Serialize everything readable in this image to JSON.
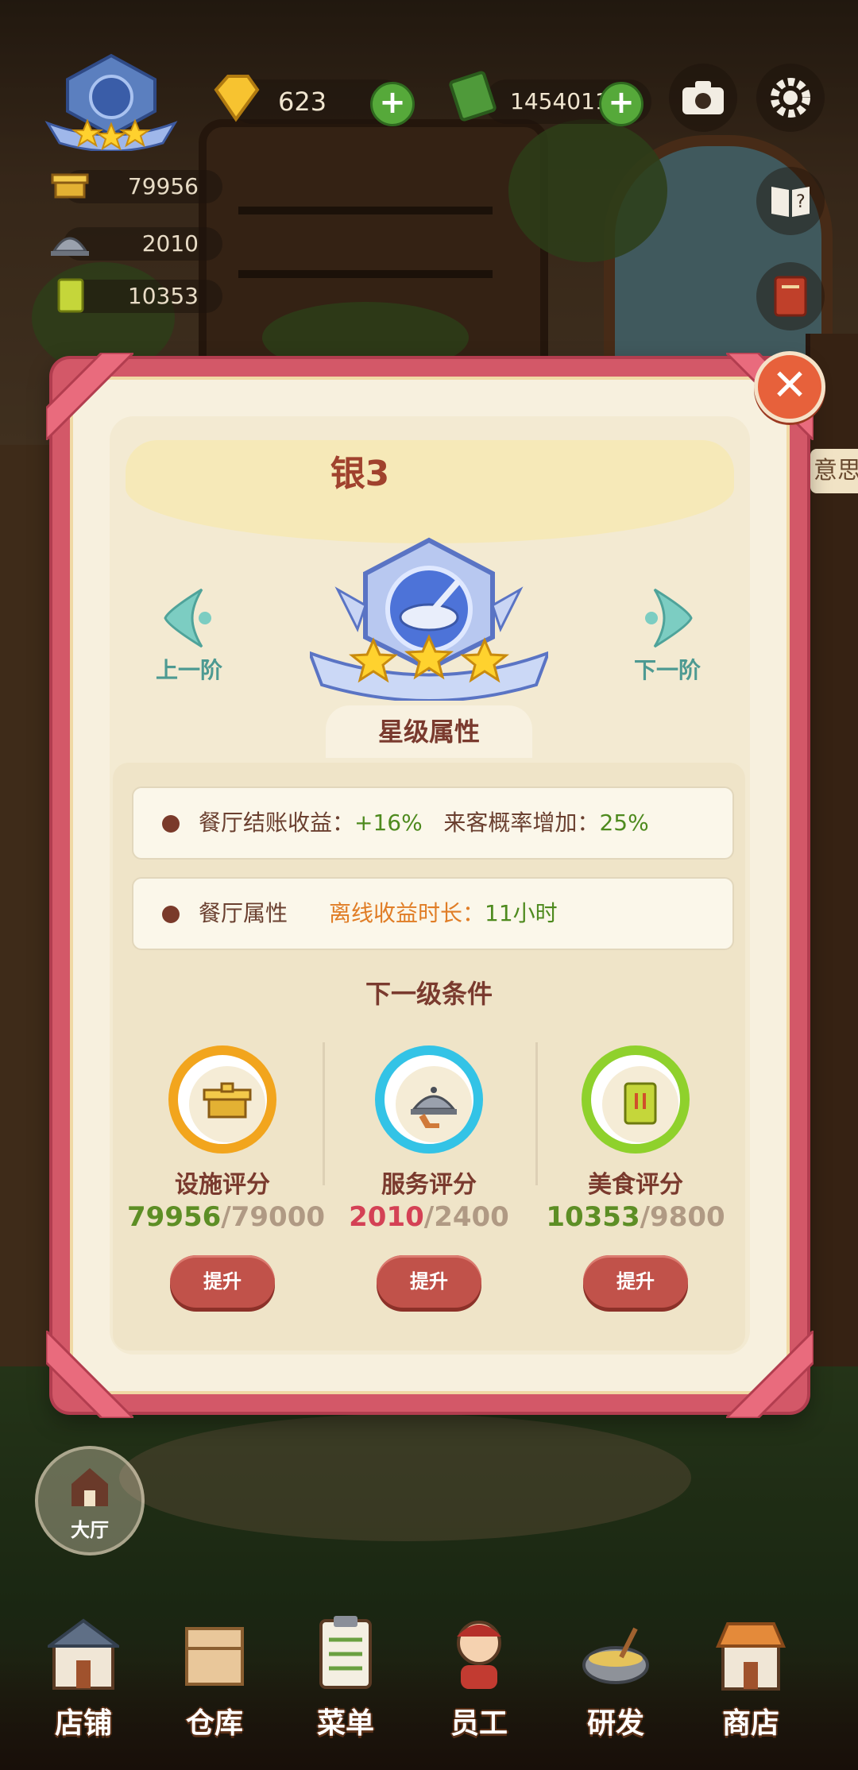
{
  "hud": {
    "gems": "623",
    "cash": "1454011",
    "stats": {
      "facility": "79956",
      "service": "2010",
      "food": "10353"
    },
    "side_hint": "意思"
  },
  "modal": {
    "title": "银3",
    "prev_label": "上一阶",
    "next_label": "下一阶",
    "section_title": "星级属性",
    "attrs": [
      {
        "k1": "餐厅结账收益：",
        "v1": "+16%",
        "k2": "来客概率增加：",
        "v2": "25%"
      },
      {
        "k1": "餐厅属性",
        "k2": "离线收益时长：",
        "v2": "11小时"
      }
    ],
    "next_title": "下一级条件",
    "requirements": [
      {
        "label": "设施评分",
        "current": "79956",
        "sep": "/",
        "required": "79000",
        "button": "提升",
        "ring_color": "#f2a51d"
      },
      {
        "label": "服务评分",
        "current": "2010",
        "sep": "/",
        "required": "2400",
        "button": "提升",
        "ring_color": "#33c3e6"
      },
      {
        "label": "美食评分",
        "current": "10353",
        "sep": "/",
        "required": "9800",
        "button": "提升",
        "ring_color": "#8fd12c"
      }
    ],
    "stars": 3
  },
  "nav": {
    "hall": "大厅",
    "items": [
      "店铺",
      "仓库",
      "菜单",
      "员工",
      "研发",
      "商店"
    ]
  }
}
